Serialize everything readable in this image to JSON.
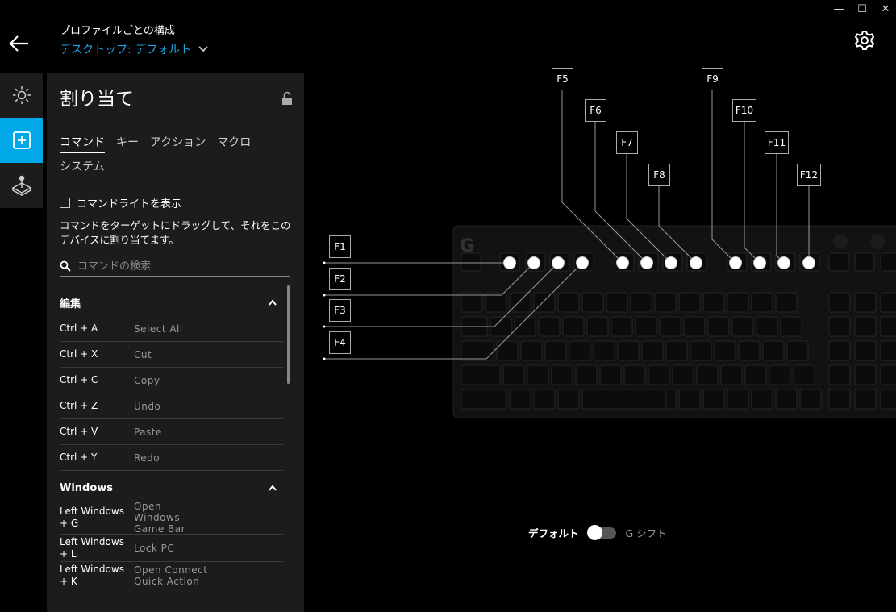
{
  "window": {
    "minimize": "—",
    "maximize": "☐",
    "close": "✕"
  },
  "header": {
    "subtitle": "プロファイルごとの構成",
    "profile": "デスクトップ: デフォルト"
  },
  "panel": {
    "title": "割り当て",
    "tabs": [
      "コマンド",
      "キー",
      "アクション",
      "マクロ",
      "システム"
    ],
    "checkbox_label": "コマンドライトを表示",
    "description": "コマンドをターゲットにドラッグして、それをこのデバイスに割り当てます。",
    "search_placeholder": "コマンドの検索",
    "sections": [
      {
        "title": "編集",
        "rows": [
          {
            "key": "Ctrl + A",
            "value": "Select All"
          },
          {
            "key": "Ctrl + X",
            "value": "Cut"
          },
          {
            "key": "Ctrl + C",
            "value": "Copy"
          },
          {
            "key": "Ctrl + Z",
            "value": "Undo"
          },
          {
            "key": "Ctrl + V",
            "value": "Paste"
          },
          {
            "key": "Ctrl + Y",
            "value": "Redo"
          }
        ]
      },
      {
        "title": "Windows",
        "rows": [
          {
            "key": "Left Windows + G",
            "value": "Open Windows Game Bar"
          },
          {
            "key": "Left Windows + L",
            "value": "Lock PC"
          },
          {
            "key": "Left Windows + K",
            "value": "Open Connect Quick Action"
          }
        ]
      }
    ]
  },
  "fkeys": [
    "F1",
    "F2",
    "F3",
    "F4",
    "F5",
    "F6",
    "F7",
    "F8",
    "F9",
    "F10",
    "F11",
    "F12"
  ],
  "toggle": {
    "left_label": "デフォルト",
    "right_label": "G シフト"
  },
  "colors": {
    "accent": "#00a8e8",
    "profile_link": "#1ea5e8",
    "panel_bg": "#1c1c1c"
  }
}
